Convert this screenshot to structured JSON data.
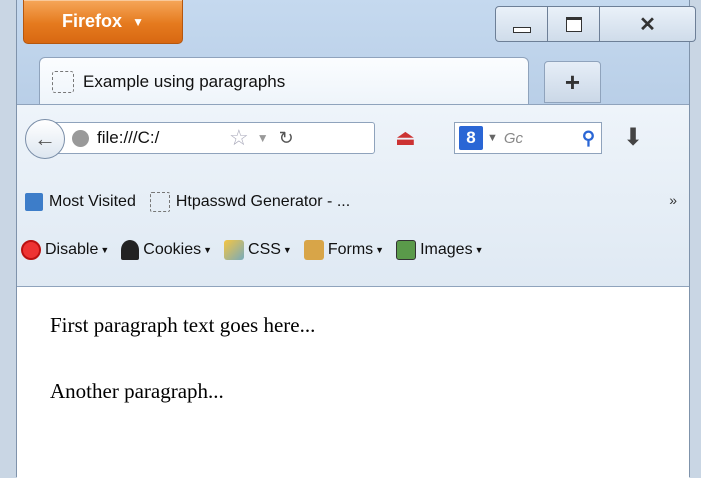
{
  "app": {
    "button_label": "Firefox"
  },
  "tab": {
    "title": "Example using paragraphs",
    "new_tab_label": "+"
  },
  "navbar": {
    "url": "file:///C:/",
    "search_engine_badge": "8",
    "search_placeholder": "Gc"
  },
  "bookmarks": {
    "items": [
      {
        "label": "Most Visited",
        "icon": "most-visited-icon"
      },
      {
        "label": "Htpasswd Generator - ...",
        "icon": "page-icon"
      }
    ],
    "overflow": "»"
  },
  "webdev_toolbar": {
    "items": [
      {
        "label": "Disable",
        "icon": "disable-icon"
      },
      {
        "label": "Cookies",
        "icon": "cookies-icon"
      },
      {
        "label": "CSS",
        "icon": "css-icon"
      },
      {
        "label": "Forms",
        "icon": "forms-icon"
      },
      {
        "label": "Images",
        "icon": "images-icon"
      }
    ]
  },
  "content": {
    "paragraphs": [
      "First paragraph text goes here...",
      "Another paragraph..."
    ]
  },
  "colors": {
    "firefox_button": "#e57a1e",
    "chrome": "#c5d9ef"
  }
}
